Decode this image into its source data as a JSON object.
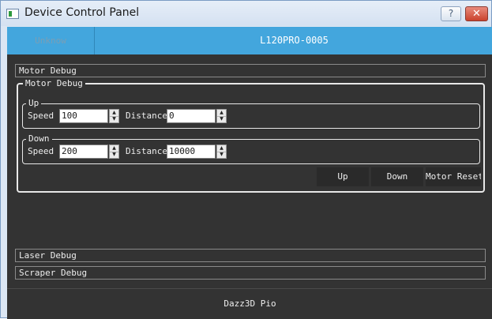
{
  "window": {
    "title": "Device Control Panel",
    "help_label": "?",
    "close_label": "✕"
  },
  "topbar": {
    "status": "Unknow",
    "device": "L120PRO-0005"
  },
  "sections": {
    "motor_header": "Motor Debug",
    "laser_header": "Laser Debug",
    "scraper_header": "Scraper Debug"
  },
  "motor": {
    "group_title": "Motor Debug",
    "up": {
      "title": "Up",
      "speed_label": "Speed",
      "speed_value": "100",
      "distance_label": "Distance",
      "distance_value": "0"
    },
    "down": {
      "title": "Down",
      "speed_label": "Speed",
      "speed_value": "200",
      "distance_label": "Distance",
      "distance_value": "10000"
    },
    "buttons": {
      "up": "Up",
      "down": "Down",
      "reset": "Motor Reset"
    }
  },
  "footer": {
    "text": "Dazz3D Pio"
  },
  "icons": {
    "app": "app-window-icon",
    "spin_up": "▲",
    "spin_down": "▼"
  },
  "colors": {
    "accent": "#43a6dd",
    "panel_bg": "#333333",
    "close": "#c9422d"
  }
}
